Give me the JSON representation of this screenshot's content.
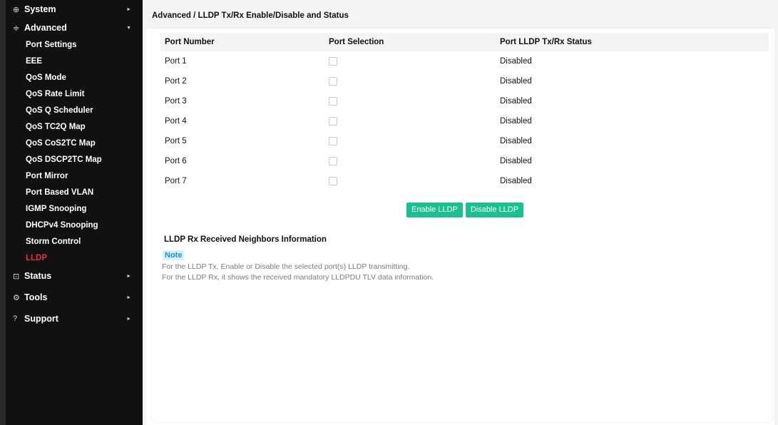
{
  "sidebar": {
    "items": [
      {
        "icon": "globe-icon",
        "glyph": "⊕",
        "label": "System",
        "arrow": "►"
      },
      {
        "icon": "sliders-icon",
        "glyph": "≑",
        "label": "Advanced",
        "arrow": "▼"
      },
      {
        "icon": "monitor-icon",
        "glyph": "⊡",
        "label": "Status",
        "arrow": "►"
      },
      {
        "icon": "gear-icon",
        "glyph": "⚙",
        "label": "Tools",
        "arrow": "►"
      },
      {
        "icon": "help-circle-icon",
        "glyph": "?",
        "label": "Support",
        "arrow": "►"
      }
    ],
    "advanced_submenu": [
      "Port Settings",
      "EEE",
      "QoS Mode",
      "QoS Rate Limit",
      "QoS Q Scheduler",
      "QoS TC2Q Map",
      "QoS CoS2TC Map",
      "QoS DSCP2TC Map",
      "Port Mirror",
      "Port Based VLAN",
      "IGMP Snooping",
      "DHCPv4 Snooping",
      "Storm Control",
      "LLDP"
    ],
    "active_submenu": "LLDP"
  },
  "breadcrumb": "Advanced / LLDP Tx/Rx Enable/Disable and Status",
  "table": {
    "headers": [
      "Port Number",
      "Port Selection",
      "Port LLDP Tx/Rx Status"
    ],
    "rows": [
      {
        "port": "Port 1",
        "selected": false,
        "status": "Disabled"
      },
      {
        "port": "Port 2",
        "selected": false,
        "status": "Disabled"
      },
      {
        "port": "Port 3",
        "selected": false,
        "status": "Disabled"
      },
      {
        "port": "Port 4",
        "selected": false,
        "status": "Disabled"
      },
      {
        "port": "Port 5",
        "selected": false,
        "status": "Disabled"
      },
      {
        "port": "Port 6",
        "selected": false,
        "status": "Disabled"
      },
      {
        "port": "Port 7",
        "selected": false,
        "status": "Disabled"
      }
    ]
  },
  "buttons": {
    "enable": "Enable LLDP",
    "disable": "Disable LLDP"
  },
  "neighbors_title": "LLDP Rx Received Neighbors Information",
  "note": {
    "label": "Note",
    "lines": [
      "For the LLDP Tx, Enable or Disable the selected port(s) LLDP transmitting.",
      "For the LLDP Rx, it shows the received mandatory LLDPDU TLV data information."
    ]
  },
  "colors": {
    "sidebar_bg": "#111111",
    "active": "#e8323c",
    "button": "#1cbf93",
    "note_badge_bg": "#d8f1fb",
    "note_badge_fg": "#1a8fd6"
  }
}
